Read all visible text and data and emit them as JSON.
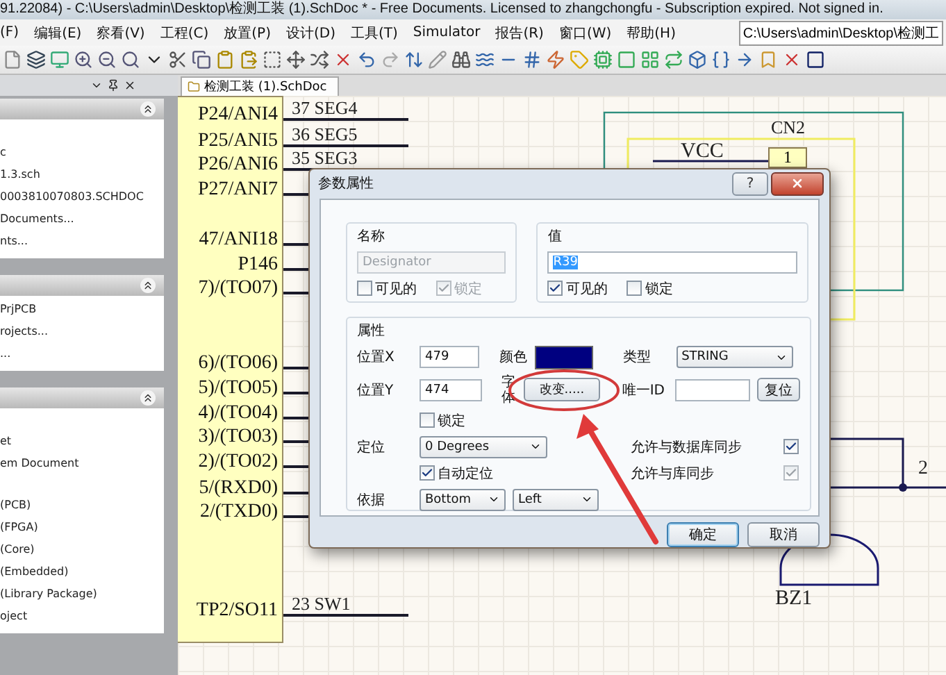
{
  "window": {
    "title": "91.22084) - C:\\Users\\admin\\Desktop\\检测工装 (1).SchDoc * - Free Documents. Licensed to zhangchongfu - Subscription expired. Not signed in."
  },
  "menu": [
    "(F)",
    "编辑(E)",
    "察看(V)",
    "工程(C)",
    "放置(P)",
    "设计(D)",
    "工具(T)",
    "Simulator",
    "报告(R)",
    "窗口(W)",
    "帮助(H)"
  ],
  "path_field": {
    "value": "C:\\Users\\admin\\Desktop\\检测工"
  },
  "left_panel": {
    "sections": [
      {
        "expanded": true,
        "items": [
          {
            "label": "c",
            "gap_before": true
          },
          {
            "label": "1.3.sch",
            "gap_before": false
          },
          {
            "label": "0003810070803.SCHDOC",
            "gap_before": false
          },
          {
            "label": "Documents...",
            "gap_before": false
          },
          {
            "label": "nts...",
            "gap_before": false
          }
        ]
      },
      {
        "expanded": true,
        "items": [
          {
            "label": "PrjPCB",
            "gap_before": false
          },
          {
            "label": "rojects...",
            "gap_before": false
          },
          {
            "label": "...",
            "gap_before": false
          }
        ]
      },
      {
        "expanded": true,
        "items": [
          {
            "label": "et",
            "gap_before": true
          },
          {
            "label": "em Document",
            "gap_before": false
          },
          {
            "label": "(PCB)",
            "gap_before": true
          },
          {
            "label": "(FPGA)",
            "gap_before": false
          },
          {
            "label": "(Core)",
            "gap_before": false
          },
          {
            "label": "(Embedded)",
            "gap_before": false
          },
          {
            "label": "(Library Package)",
            "gap_before": false
          },
          {
            "label": "oject",
            "gap_before": false
          }
        ]
      }
    ]
  },
  "tabs": [
    {
      "label": "检测工装 (1).SchDoc"
    }
  ],
  "schematic": {
    "pins": [
      {
        "label": "P24/ANI4",
        "net": "37 SEG4"
      },
      {
        "label": "P25/ANI5",
        "net": "36 SEG5"
      },
      {
        "label": "P26/ANI6",
        "net": "35 SEG3"
      },
      {
        "label": "P27/ANI7"
      },
      {
        "label": "47/ANI18"
      },
      {
        "label": "P146"
      },
      {
        "label": "7)/(TO07)"
      },
      {
        "label": "6)/(TO06)"
      },
      {
        "label": "5)/(TO05)"
      },
      {
        "label": "4)/(TO04)"
      },
      {
        "label": "3)/(TO03)"
      },
      {
        "label": "2)/(TO02)"
      },
      {
        "label": "5/(RXD0)"
      },
      {
        "label": "2/(TXD0)"
      },
      {
        "label": "TP2/SO11",
        "net": "23 SW1"
      }
    ],
    "connector": {
      "net": "VCC",
      "designator": "CN2",
      "pin": "1"
    },
    "buzzer": {
      "designator": "BZ1",
      "pin": "2"
    }
  },
  "dialog": {
    "title": "参数属性",
    "help_button": "?",
    "name_group": {
      "title": "名称",
      "field": {
        "value": "Designator",
        "disabled": true
      },
      "visible": {
        "label": "可见的",
        "checked": false,
        "disabled": false
      },
      "locked": {
        "label": "锁定",
        "checked": true,
        "disabled": true
      }
    },
    "value_group": {
      "title": "值",
      "field": {
        "value": "R39",
        "disabled": false,
        "text_selected": true
      },
      "visible": {
        "label": "可见的",
        "checked": true,
        "disabled": false
      },
      "locked": {
        "label": "锁定",
        "checked": false,
        "disabled": false
      }
    },
    "properties": {
      "title": "属性",
      "pos_x": {
        "label": "位置X",
        "value": "479"
      },
      "pos_y": {
        "label": "位置Y",
        "value": "474"
      },
      "color": {
        "label": "颜色",
        "color": "#000080"
      },
      "type": {
        "label": "类型",
        "value": "STRING"
      },
      "font": {
        "label": "字体",
        "button": "改变....."
      },
      "unique_id": {
        "label": "唯一ID",
        "button": "复位"
      },
      "lock": {
        "label": "锁定",
        "checked": false,
        "disabled": false
      },
      "orientation": {
        "label": "定位",
        "value": "0 Degrees"
      },
      "autoposition": {
        "label": "自动定位",
        "checked": true,
        "disabled": false
      },
      "db_sync": {
        "label": "允许与数据库同步",
        "checked": true,
        "disabled": false
      },
      "lib_sync": {
        "label": "允许与库同步",
        "checked": true,
        "disabled": true
      },
      "justification": {
        "label": "依据",
        "vertical": "Bottom",
        "horizontal": "Left"
      }
    },
    "buttons": [
      {
        "label": "确定",
        "default": true
      },
      {
        "label": "取消",
        "default": false
      }
    ]
  }
}
